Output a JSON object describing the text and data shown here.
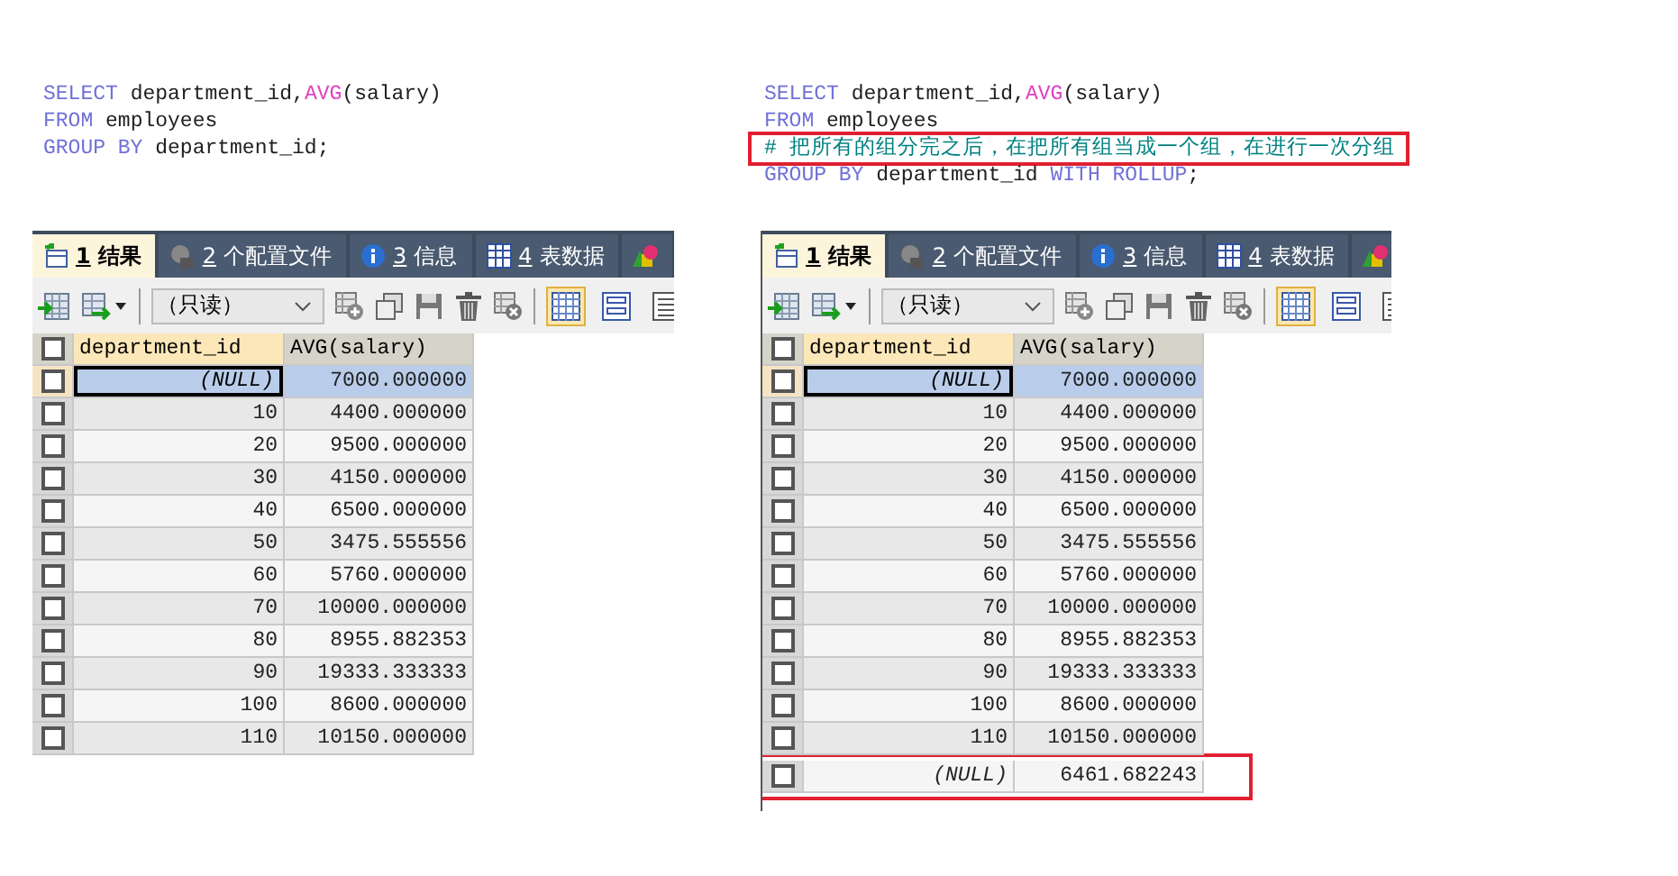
{
  "panels": [
    {
      "sql": [
        {
          "highlighted": false,
          "tokens": [
            {
              "kind": "keyword",
              "text": "SELECT"
            },
            {
              "kind": "plain",
              "text": " department_id,"
            },
            {
              "kind": "function",
              "text": "AVG"
            },
            {
              "kind": "plain",
              "text": "(salary)"
            }
          ]
        },
        {
          "highlighted": false,
          "tokens": [
            {
              "kind": "keyword",
              "text": "FROM"
            },
            {
              "kind": "plain",
              "text": " employees"
            }
          ]
        },
        {
          "highlighted": false,
          "tokens": [
            {
              "kind": "keyword",
              "text": "GROUP BY"
            },
            {
              "kind": "plain",
              "text": " department_id;"
            }
          ]
        }
      ],
      "tabs": [
        {
          "kind": "result",
          "number": "1",
          "label": "结果",
          "selected": true
        },
        {
          "kind": "profile",
          "number": "2",
          "label": "个配置文件",
          "selected": false
        },
        {
          "kind": "info",
          "number": "3",
          "label": "信息",
          "selected": false
        },
        {
          "kind": "table",
          "number": "4",
          "label": "表数据",
          "selected": false
        },
        {
          "kind": "chart",
          "selected": false
        }
      ],
      "mode_select": "（只读）",
      "view_buttons": [
        {
          "kind": "grid",
          "selected": true
        },
        {
          "kind": "form",
          "selected": false
        },
        {
          "kind": "text",
          "selected": false
        }
      ],
      "columns": [
        {
          "label": "department_id",
          "selected": true
        },
        {
          "label": "AVG(salary)",
          "selected": false
        }
      ],
      "header_checked": false,
      "rows": [
        {
          "department_id": "(NULL)",
          "is_null": true,
          "avg": "7000.000000",
          "selected": true,
          "checked": false,
          "highlighted": false
        },
        {
          "department_id": "10",
          "is_null": false,
          "avg": "4400.000000",
          "selected": false,
          "checked": false,
          "highlighted": false
        },
        {
          "department_id": "20",
          "is_null": false,
          "avg": "9500.000000",
          "selected": false,
          "checked": false,
          "highlighted": false
        },
        {
          "department_id": "30",
          "is_null": false,
          "avg": "4150.000000",
          "selected": false,
          "checked": false,
          "highlighted": false
        },
        {
          "department_id": "40",
          "is_null": false,
          "avg": "6500.000000",
          "selected": false,
          "checked": false,
          "highlighted": false
        },
        {
          "department_id": "50",
          "is_null": false,
          "avg": "3475.555556",
          "selected": false,
          "checked": false,
          "highlighted": false
        },
        {
          "department_id": "60",
          "is_null": false,
          "avg": "5760.000000",
          "selected": false,
          "checked": false,
          "highlighted": false
        },
        {
          "department_id": "70",
          "is_null": false,
          "avg": "10000.000000",
          "selected": false,
          "checked": false,
          "highlighted": false
        },
        {
          "department_id": "80",
          "is_null": false,
          "avg": "8955.882353",
          "selected": false,
          "checked": false,
          "highlighted": false
        },
        {
          "department_id": "90",
          "is_null": false,
          "avg": "19333.333333",
          "selected": false,
          "checked": false,
          "highlighted": false
        },
        {
          "department_id": "100",
          "is_null": false,
          "avg": "8600.000000",
          "selected": false,
          "checked": false,
          "highlighted": false
        },
        {
          "department_id": "110",
          "is_null": false,
          "avg": "10150.000000",
          "selected": false,
          "checked": false,
          "highlighted": false
        }
      ]
    },
    {
      "sql": [
        {
          "highlighted": false,
          "tokens": [
            {
              "kind": "keyword",
              "text": "SELECT"
            },
            {
              "kind": "plain",
              "text": " department_id,"
            },
            {
              "kind": "function",
              "text": "AVG"
            },
            {
              "kind": "plain",
              "text": "(salary)"
            }
          ]
        },
        {
          "highlighted": false,
          "tokens": [
            {
              "kind": "keyword",
              "text": "FROM"
            },
            {
              "kind": "plain",
              "text": " employees"
            }
          ]
        },
        {
          "highlighted": true,
          "tokens": [
            {
              "kind": "comment",
              "text": "# 把所有的组分完之后，在把所有组当成一个组，在进行一次分组"
            }
          ]
        },
        {
          "highlighted": false,
          "tokens": [
            {
              "kind": "keyword",
              "text": "GROUP BY"
            },
            {
              "kind": "plain",
              "text": " department_id "
            },
            {
              "kind": "keyword",
              "text": "WITH ROLLUP"
            },
            {
              "kind": "plain",
              "text": ";"
            }
          ]
        }
      ],
      "tabs": [
        {
          "kind": "result",
          "number": "1",
          "label": "结果",
          "selected": true
        },
        {
          "kind": "profile",
          "number": "2",
          "label": "个配置文件",
          "selected": false
        },
        {
          "kind": "info",
          "number": "3",
          "label": "信息",
          "selected": false
        },
        {
          "kind": "table",
          "number": "4",
          "label": "表数据",
          "selected": false
        },
        {
          "kind": "chart",
          "selected": false
        }
      ],
      "mode_select": "（只读）",
      "view_buttons": [
        {
          "kind": "grid",
          "selected": true
        },
        {
          "kind": "form",
          "selected": false
        },
        {
          "kind": "text",
          "selected": false
        }
      ],
      "columns": [
        {
          "label": "department_id",
          "selected": true
        },
        {
          "label": "AVG(salary)",
          "selected": false
        }
      ],
      "header_checked": false,
      "rows": [
        {
          "department_id": "(NULL)",
          "is_null": true,
          "avg": "7000.000000",
          "selected": true,
          "checked": false,
          "highlighted": false
        },
        {
          "department_id": "10",
          "is_null": false,
          "avg": "4400.000000",
          "selected": false,
          "checked": false,
          "highlighted": false
        },
        {
          "department_id": "20",
          "is_null": false,
          "avg": "9500.000000",
          "selected": false,
          "checked": false,
          "highlighted": false
        },
        {
          "department_id": "30",
          "is_null": false,
          "avg": "4150.000000",
          "selected": false,
          "checked": false,
          "highlighted": false
        },
        {
          "department_id": "40",
          "is_null": false,
          "avg": "6500.000000",
          "selected": false,
          "checked": false,
          "highlighted": false
        },
        {
          "department_id": "50",
          "is_null": false,
          "avg": "3475.555556",
          "selected": false,
          "checked": false,
          "highlighted": false
        },
        {
          "department_id": "60",
          "is_null": false,
          "avg": "5760.000000",
          "selected": false,
          "checked": false,
          "highlighted": false
        },
        {
          "department_id": "70",
          "is_null": false,
          "avg": "10000.000000",
          "selected": false,
          "checked": false,
          "highlighted": false
        },
        {
          "department_id": "80",
          "is_null": false,
          "avg": "8955.882353",
          "selected": false,
          "checked": false,
          "highlighted": false
        },
        {
          "department_id": "90",
          "is_null": false,
          "avg": "19333.333333",
          "selected": false,
          "checked": false,
          "highlighted": false
        },
        {
          "department_id": "100",
          "is_null": false,
          "avg": "8600.000000",
          "selected": false,
          "checked": false,
          "highlighted": false
        },
        {
          "department_id": "110",
          "is_null": false,
          "avg": "10150.000000",
          "selected": false,
          "checked": false,
          "highlighted": false
        },
        {
          "department_id": "(NULL)",
          "is_null": true,
          "avg": "6461.682243",
          "selected": false,
          "checked": false,
          "highlighted": true
        }
      ]
    }
  ]
}
